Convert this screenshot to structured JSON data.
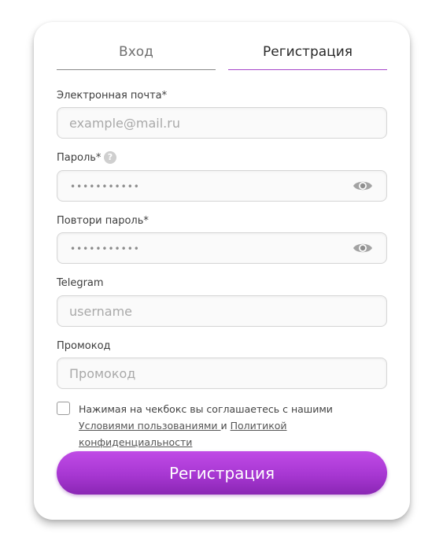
{
  "tabs": {
    "login": "Вход",
    "register": "Регистрация"
  },
  "form": {
    "email": {
      "label": "Электронная почта*",
      "placeholder": "example@mail.ru",
      "value": ""
    },
    "password": {
      "label": "Пароль*",
      "help": "?",
      "masked_value": "•••••••••••"
    },
    "password_repeat": {
      "label": "Повтори пароль*",
      "masked_value": "•••••••••••"
    },
    "telegram": {
      "label": "Telegram",
      "placeholder": "username",
      "value": ""
    },
    "promo": {
      "label": "Промокод",
      "placeholder": "Промокод",
      "value": ""
    },
    "agreement": {
      "checked": false,
      "text_before": "Нажимая на чекбокс вы соглашаетесь с нашими ",
      "terms_link": "Условиями пользованиями ",
      "text_between": "и ",
      "privacy_link": "Политикой конфиденциальности"
    },
    "submit_label": "Регистрация"
  },
  "icons": {
    "eye": "eye-icon",
    "help": "question-circle-icon"
  },
  "colors": {
    "accent": "#a646c9",
    "button_top": "#c04be6",
    "button_bottom": "#8a26b4"
  }
}
